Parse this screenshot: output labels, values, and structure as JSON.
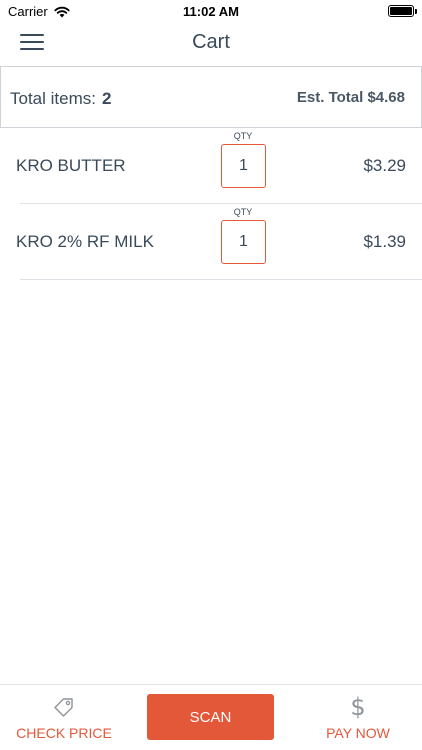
{
  "status_bar": {
    "carrier": "Carrier",
    "time": "11:02 AM"
  },
  "nav": {
    "title": "Cart",
    "menu_icon": "hamburger-menu-icon"
  },
  "summary": {
    "total_items_label": "Total items:",
    "total_items_count": "2",
    "est_total": "Est. Total $4.68"
  },
  "cart": {
    "qty_label": "QTY",
    "items": [
      {
        "name": "KRO BUTTER",
        "qty": "1",
        "price": "$3.29"
      },
      {
        "name": "KRO 2% RF MILK",
        "qty": "1",
        "price": "$1.39"
      }
    ]
  },
  "bottom_bar": {
    "check_price_label": "CHECK PRICE",
    "check_price_icon": "price-tag-icon",
    "scan_label": "SCAN",
    "pay_now_label": "PAY NOW",
    "pay_now_icon": "dollar-icon",
    "pay_icon_glyph": "$"
  },
  "colors": {
    "accent": "#e4583a",
    "text": "#3a4a5a",
    "divider": "#dcdfe3"
  }
}
